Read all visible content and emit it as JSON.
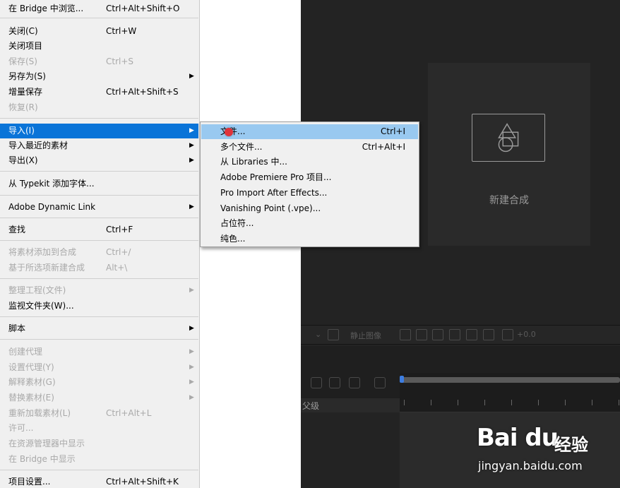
{
  "file_menu": {
    "items": [
      {
        "label": "在 Bridge 中浏览...",
        "shortcut": "Ctrl+Alt+Shift+O"
      },
      {
        "label": "关闭(C)",
        "shortcut": "Ctrl+W"
      },
      {
        "label": "关闭项目",
        "shortcut": ""
      },
      {
        "label": "保存(S)",
        "shortcut": "Ctrl+S"
      },
      {
        "label": "另存为(S)",
        "shortcut": ""
      },
      {
        "label": "增量保存",
        "shortcut": "Ctrl+Alt+Shift+S"
      },
      {
        "label": "恢复(R)",
        "shortcut": ""
      },
      {
        "label": "导入(I)",
        "shortcut": ""
      },
      {
        "label": "导入最近的素材",
        "shortcut": ""
      },
      {
        "label": "导出(X)",
        "shortcut": ""
      },
      {
        "label": "从 Typekit 添加字体...",
        "shortcut": ""
      },
      {
        "label": "Adobe Dynamic Link",
        "shortcut": ""
      },
      {
        "label": "查找",
        "shortcut": "Ctrl+F"
      },
      {
        "label": "将素材添加到合成",
        "shortcut": "Ctrl+/"
      },
      {
        "label": "基于所选项新建合成",
        "shortcut": "Alt+\\"
      },
      {
        "label": "整理工程(文件)",
        "shortcut": ""
      },
      {
        "label": "监视文件夹(W)...",
        "shortcut": ""
      },
      {
        "label": "脚本",
        "shortcut": ""
      },
      {
        "label": "创建代理",
        "shortcut": ""
      },
      {
        "label": "设置代理(Y)",
        "shortcut": ""
      },
      {
        "label": "解释素材(G)",
        "shortcut": ""
      },
      {
        "label": "替换素材(E)",
        "shortcut": ""
      },
      {
        "label": "重新加载素材(L)",
        "shortcut": "Ctrl+Alt+L"
      },
      {
        "label": "许可...",
        "shortcut": ""
      },
      {
        "label": "在资源管理器中显示",
        "shortcut": ""
      },
      {
        "label": "在 Bridge 中显示",
        "shortcut": ""
      },
      {
        "label": "项目设置...",
        "shortcut": "Ctrl+Alt+Shift+K"
      }
    ]
  },
  "import_submenu": {
    "items": [
      {
        "label": "文件...",
        "shortcut": "Ctrl+I"
      },
      {
        "label": "多个文件...",
        "shortcut": "Ctrl+Alt+I"
      },
      {
        "label": "从 Libraries 中...",
        "shortcut": ""
      },
      {
        "label": "Adobe Premiere Pro 项目...",
        "shortcut": ""
      },
      {
        "label": "Pro Import After Effects...",
        "shortcut": ""
      },
      {
        "label": "Vanishing Point (.vpe)...",
        "shortcut": ""
      },
      {
        "label": "占位符...",
        "shortcut": ""
      },
      {
        "label": "纯色...",
        "shortcut": ""
      }
    ]
  },
  "composition": {
    "new_comp_label": "新建合成"
  },
  "viewer_bar": {
    "snapshot_label": "静止图像",
    "exposure_value": "+0.0"
  },
  "timeline": {
    "parent_header": "父级"
  },
  "watermark": {
    "brand": "Bai du",
    "cn": "经验",
    "url": "jingyan.baidu.com"
  },
  "colors": {
    "highlight": "#0a74d8",
    "submenu_highlight": "#99c9f0",
    "timeline_marker": "#3d7de0"
  }
}
